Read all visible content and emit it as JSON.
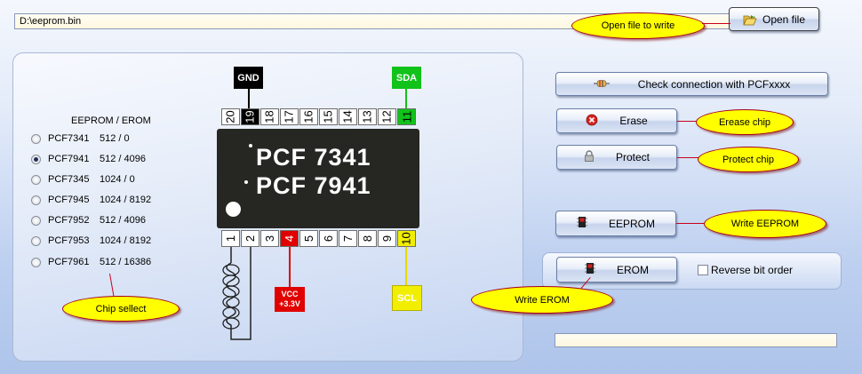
{
  "file": {
    "path": "D:\\eeprom.bin",
    "open_label": "Open file"
  },
  "callouts": {
    "open_file": "Open file to write",
    "erase": "Erease chip",
    "protect": "Protect chip",
    "write_eeprom": "Write EEPROM",
    "write_erom": "Write EROM",
    "chip_select": "Chip sellect"
  },
  "chip_list": {
    "title": "EEPROM / EROM",
    "selected_index": 1,
    "items": [
      {
        "name": "PCF7341",
        "size": "512 / 0"
      },
      {
        "name": "PCF7941",
        "size": "512 / 4096"
      },
      {
        "name": "PCF7345",
        "size": "1024 / 0"
      },
      {
        "name": "PCF7945",
        "size": "1024 / 8192"
      },
      {
        "name": "PCF7952",
        "size": "512 / 4096"
      },
      {
        "name": "PCF7953",
        "size": "1024 / 8192"
      },
      {
        "name": "PCF7961",
        "size": "512 / 16386"
      }
    ]
  },
  "chip": {
    "line1": "PCF 7341",
    "line2": "PCF 7941",
    "pins_top": [
      "20",
      "19",
      "18",
      "17",
      "16",
      "15",
      "14",
      "13",
      "12",
      "11"
    ],
    "pins_bottom": [
      "1",
      "2",
      "3",
      "4",
      "5",
      "6",
      "7",
      "8",
      "9",
      "10"
    ],
    "gnd": "GND",
    "sda": "SDA",
    "scl": "SCL",
    "vcc_line1": "VCC",
    "vcc_line2": "+3.3V"
  },
  "actions": {
    "check": "Check connection with PCFxxxx",
    "erase": "Erase",
    "protect": "Protect",
    "eeprom": "EEPROM",
    "erom": "EROM",
    "reverse": "Reverse bit order"
  },
  "status": "",
  "colors": {
    "gnd": "#000000",
    "sda": "#11c21a",
    "scl": "#f2ee00",
    "vcc": "#e00000",
    "callout": "#ffff00"
  }
}
